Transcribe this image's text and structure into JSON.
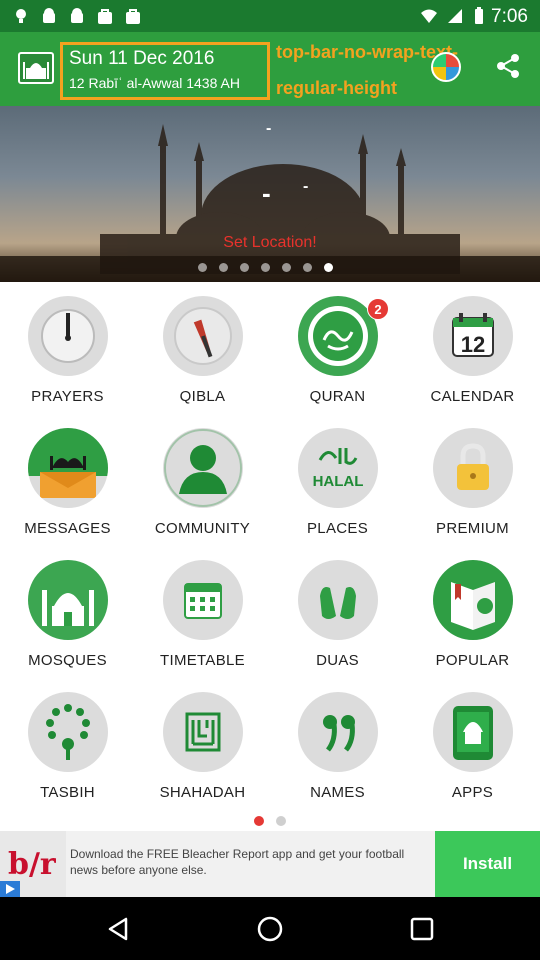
{
  "status_bar": {
    "time": "7:06",
    "left_icons": [
      "bulb-icon",
      "android-icon",
      "android-icon",
      "bag-icon",
      "bag-icon"
    ],
    "right_icons": [
      "wifi-icon",
      "signal-icon",
      "battery-icon"
    ]
  },
  "top_bar": {
    "date_gregorian": "Sun 11 Dec 2016",
    "date_hijri": "12 Rabīʿ al-Awwal 1438 AH",
    "title": "top-bar-no-wrap-text-regular-height",
    "accent_color": "#f3a21f",
    "bar_color": "#2e9e3e"
  },
  "banner": {
    "dash_1": "-",
    "dash_2": "-",
    "dash_3": "-",
    "set_location": "Set Location!",
    "dot_count": 7,
    "active_dot": 6
  },
  "grid": {
    "items": [
      {
        "label": "PRAYERS",
        "icon": "clock-icon"
      },
      {
        "label": "QIBLA",
        "icon": "compass-icon"
      },
      {
        "label": "QURAN",
        "icon": "quran-icon",
        "badge": "2"
      },
      {
        "label": "CALENDAR",
        "icon": "calendar-icon",
        "day": "12"
      },
      {
        "label": "MESSAGES",
        "icon": "mosque-envelope-icon"
      },
      {
        "label": "COMMUNITY",
        "icon": "people-icon"
      },
      {
        "label": "PLACES",
        "icon": "halal-icon",
        "icon_text": "HALAL"
      },
      {
        "label": "PREMIUM",
        "icon": "lock-icon"
      },
      {
        "label": "MOSQUES",
        "icon": "mosque-icon"
      },
      {
        "label": "TIMETABLE",
        "icon": "timetable-icon"
      },
      {
        "label": "DUAS",
        "icon": "praying-hands-icon"
      },
      {
        "label": "POPULAR",
        "icon": "book-icon"
      },
      {
        "label": "TASBIH",
        "icon": "beads-icon"
      },
      {
        "label": "SHAHADAH",
        "icon": "calligraphy-icon"
      },
      {
        "label": "NAMES",
        "icon": "names-icon"
      },
      {
        "label": "APPS",
        "icon": "apps-icon"
      }
    ]
  },
  "pager": {
    "count": 2,
    "active": 0
  },
  "ad": {
    "logo_text": "b/r",
    "text": "Download the FREE Bleacher Report app and get your football news before anyone else.",
    "install_label": "Install"
  },
  "nav": {
    "icons": [
      "back-icon",
      "home-icon",
      "recents-icon"
    ]
  }
}
